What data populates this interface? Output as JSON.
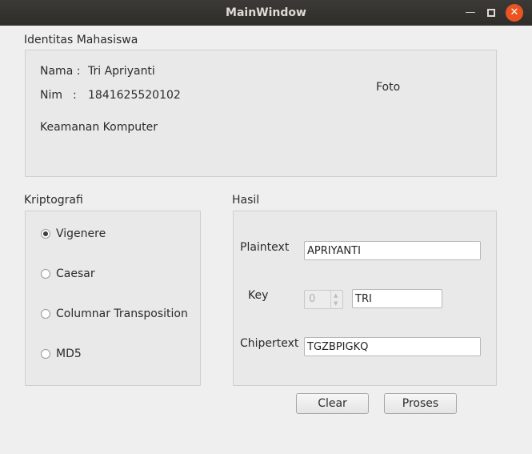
{
  "window": {
    "title": "MainWindow"
  },
  "identity": {
    "group_title": "Identitas Mahasiswa",
    "nama_label": "Nama :",
    "nama_value": "Tri Apriyanti",
    "nim_label": "Nim",
    "nim_colon": ":",
    "nim_value": "1841625520102",
    "course": "Keamanan Komputer",
    "foto_label": "Foto"
  },
  "kriptografi": {
    "group_title": "Kriptografi",
    "options": [
      {
        "label": "Vigenere",
        "checked": true
      },
      {
        "label": "Caesar",
        "checked": false
      },
      {
        "label": "Columnar Transposition",
        "checked": false
      },
      {
        "label": "MD5",
        "checked": false
      }
    ]
  },
  "hasil": {
    "group_title": "Hasil",
    "plaintext_label": "Plaintext",
    "plaintext_value": "APRIYANTI",
    "key_label": "Key",
    "key_spin_value": "0",
    "key_value": "TRI",
    "chipertext_label": "Chipertext",
    "chipertext_value": "TGZBPIGKQ"
  },
  "buttons": {
    "clear": "Clear",
    "proses": "Proses"
  }
}
